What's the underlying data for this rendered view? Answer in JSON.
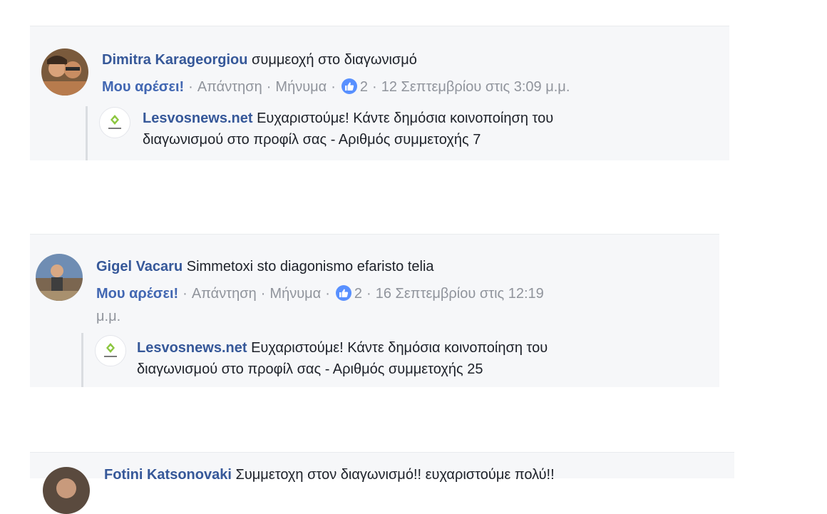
{
  "comments": [
    {
      "author": "Dimitra Karageorgiou",
      "text": "συμμεοχή στο διαγωνισμό",
      "like_label": "Μου αρέσει!",
      "reply_label": "Απάντηση",
      "message_label": "Μήνυμα",
      "like_count": "2",
      "timestamp": "12 Σεπτεμβρίου στις 3:09 μ.μ.",
      "reply": {
        "author": "Lesvosnews.net",
        "text_line1": "Ευχαριστούμε! Κάντε δημόσια κοινοποίηση του",
        "text_line2": "διαγωνισμού στο προφίλ σας - Αριθμός συμμετοχής 7"
      }
    },
    {
      "author": "Gigel Vacaru",
      "text": "Simmetoxi sto diagonismo efaristo telia",
      "like_label": "Μου αρέσει!",
      "reply_label": "Απάντηση",
      "message_label": "Μήνυμα",
      "like_count": "2",
      "timestamp": "16 Σεπτεμβρίου στις 12:19",
      "timestamp_cont": "μ.μ.",
      "reply": {
        "author": "Lesvosnews.net",
        "text_line1": "Ευχαριστούμε! Κάντε δημόσια κοινοποίηση του",
        "text_line2": "διαγωνισμού στο προφίλ σας - Αριθμός συμμετοχής 25"
      }
    },
    {
      "author": "Fotini Katsonovaki",
      "text": "Συμμετοχη στον διαγωνισμό!! ευχαριστούμε πολύ!!"
    }
  ],
  "colors": {
    "card_bg": "#f6f7f9",
    "author": "#365899",
    "like_link": "#4267b2",
    "meta": "#90949c",
    "like_badge": "#5890ff"
  },
  "icons": {
    "like_badge": "thumbs-up-icon",
    "page_logo": "lesvosnews-logo-icon"
  }
}
